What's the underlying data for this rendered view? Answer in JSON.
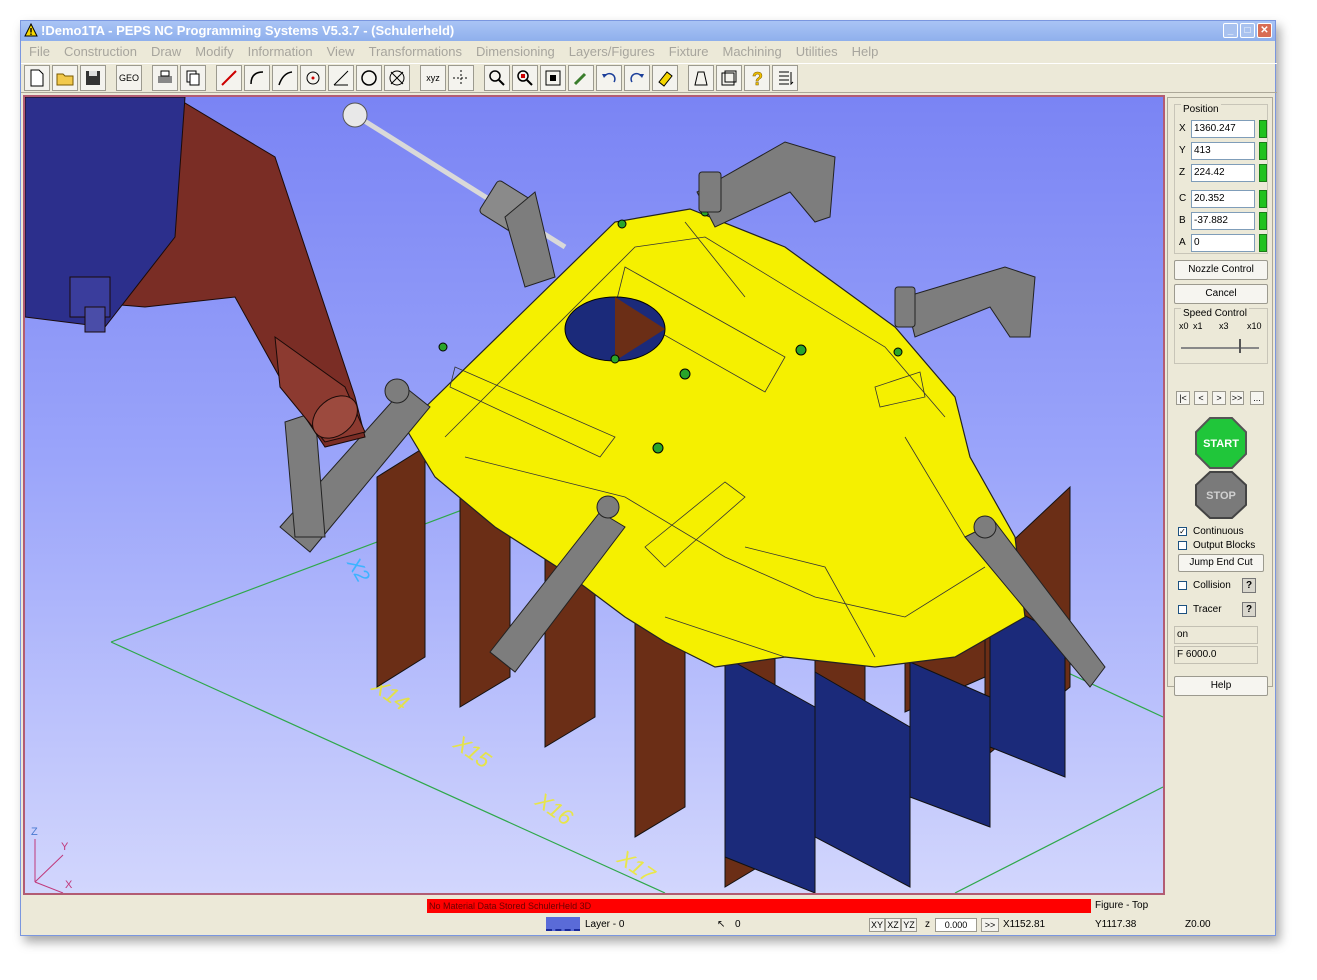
{
  "window": {
    "title": "!Demo1TA - PEPS NC Programming Systems V5.3.7 - (Schulerheld)"
  },
  "menu": [
    "File",
    "Construction",
    "Draw",
    "Modify",
    "Information",
    "View",
    "Transformations",
    "Dimensioning",
    "Layers/Figures",
    "Fixture",
    "Machining",
    "Utilities",
    "Help"
  ],
  "toolbar": {
    "xyz_label": "xyz",
    "geo_label": "GEO"
  },
  "viewport": {
    "grid_labels": [
      "X14",
      "X15",
      "X16",
      "X17",
      "X2"
    ],
    "axis_labels": {
      "z": "Z",
      "y": "Y",
      "x": "X"
    },
    "colors": {
      "part": "#f5f000",
      "fin_brown": "#6b2e16",
      "fin_blue": "#1b2a7a",
      "robot": "#7a2d25",
      "clamp": "#7d7d7d",
      "grid": "#2ea84a"
    }
  },
  "panel": {
    "position_title": "Position",
    "position": [
      {
        "axis": "X",
        "value": "1360.247"
      },
      {
        "axis": "Y",
        "value": "413"
      },
      {
        "axis": "Z",
        "value": "224.42"
      },
      {
        "axis": "C",
        "value": "20.352"
      },
      {
        "axis": "B",
        "value": "-37.882"
      },
      {
        "axis": "A",
        "value": "0"
      }
    ],
    "nozzle_control": "Nozzle Control",
    "cancel": "Cancel",
    "speed_title": "Speed Control",
    "speed_ticks": [
      "x0",
      "x1",
      "x3",
      "x10"
    ],
    "nav": [
      "|<",
      "<",
      ">",
      ">>",
      "..."
    ],
    "start": "START",
    "stop": "STOP",
    "continuous": "Continuous",
    "continuous_checked": true,
    "output_blocks": "Output Blocks",
    "output_blocks_checked": false,
    "jump_end_cut": "Jump End Cut",
    "collision": "Collision",
    "tracer": "Tracer",
    "help_q": "?",
    "field_on": "on",
    "feed": "F 6000.0",
    "help": "Help"
  },
  "status": {
    "message": "No Material Data Stored SchulerHeld 3D",
    "figure": "Figure - Top",
    "layer": "Layer - 0",
    "angle": "0",
    "plane_xy": "XY",
    "plane_xz": "XZ",
    "plane_yz": "YZ",
    "z_label": "z",
    "z_value": "0.000",
    "go": ">>",
    "x_coord": "X1152.81",
    "y_coord": "Y1117.38",
    "z_coord": "Z0.00"
  }
}
